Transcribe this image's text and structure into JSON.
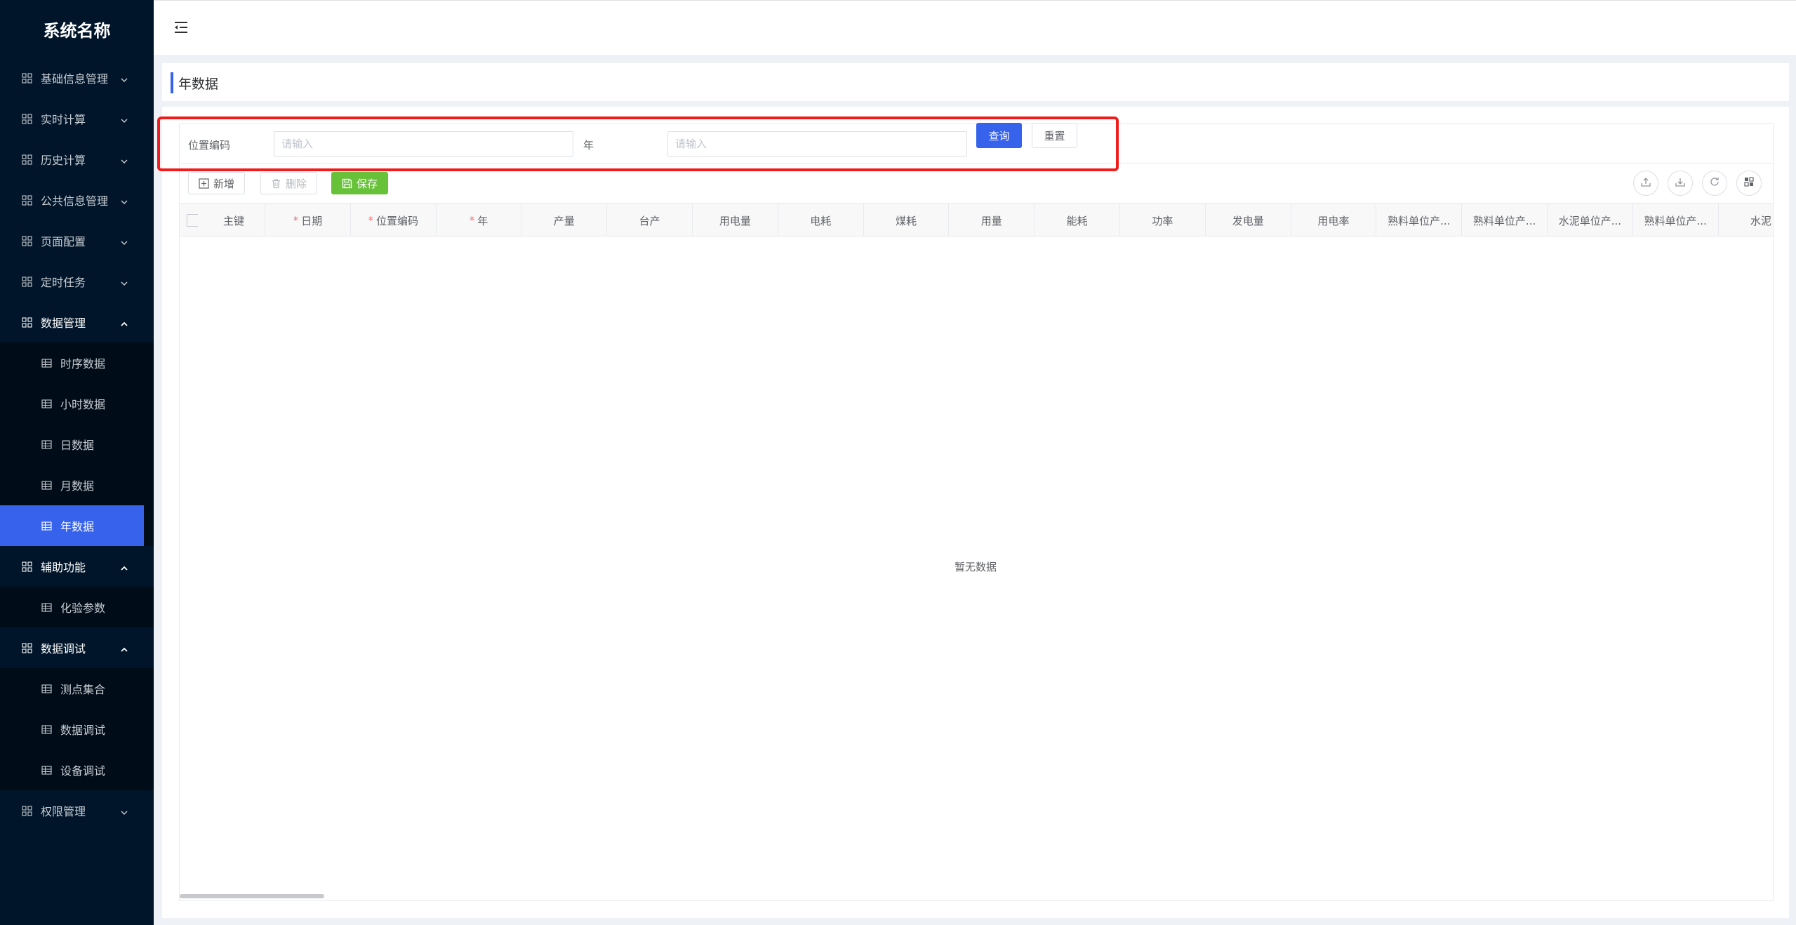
{
  "app": {
    "title": "系统名称"
  },
  "sidebar": {
    "items": [
      {
        "label": "基础信息管理",
        "open": false
      },
      {
        "label": "实时计算",
        "open": false
      },
      {
        "label": "历史计算",
        "open": false
      },
      {
        "label": "公共信息管理",
        "open": false
      },
      {
        "label": "页面配置",
        "open": false
      },
      {
        "label": "定时任务",
        "open": false
      },
      {
        "label": "数据管理",
        "open": true,
        "children": [
          "时序数据",
          "小时数据",
          "日数据",
          "月数据",
          "年数据"
        ],
        "active_child": "年数据"
      },
      {
        "label": "辅助功能",
        "open": true,
        "children": [
          "化验参数"
        ]
      },
      {
        "label": "数据调试",
        "open": true,
        "children": [
          "测点集合",
          "数据调试",
          "设备调试"
        ]
      },
      {
        "label": "权限管理",
        "open": false
      }
    ]
  },
  "page": {
    "title": "年数据"
  },
  "search": {
    "location_label": "位置编码",
    "location_placeholder": "请输入",
    "year_label": "年",
    "year_placeholder": "请输入",
    "query_label": "查询",
    "reset_label": "重置"
  },
  "toolbar": {
    "add_label": "新增",
    "delete_label": "删除",
    "save_label": "保存"
  },
  "table": {
    "columns": [
      {
        "label": "主键",
        "required": false
      },
      {
        "label": "日期",
        "required": true
      },
      {
        "label": "位置编码",
        "required": true
      },
      {
        "label": "年",
        "required": true
      },
      {
        "label": "产量",
        "required": false
      },
      {
        "label": "台产",
        "required": false
      },
      {
        "label": "用电量",
        "required": false
      },
      {
        "label": "电耗",
        "required": false
      },
      {
        "label": "煤耗",
        "required": false
      },
      {
        "label": "用量",
        "required": false
      },
      {
        "label": "能耗",
        "required": false
      },
      {
        "label": "功率",
        "required": false
      },
      {
        "label": "发电量",
        "required": false
      },
      {
        "label": "用电率",
        "required": false
      },
      {
        "label": "熟料单位产...",
        "required": false
      },
      {
        "label": "熟料单位产...",
        "required": false
      },
      {
        "label": "水泥单位产...",
        "required": false
      },
      {
        "label": "熟料单位产...",
        "required": false
      },
      {
        "label": "水泥",
        "required": false
      }
    ],
    "empty_text": "暂无数据"
  },
  "colors": {
    "sidebar_bg": "#001529",
    "accent": "#3662ec",
    "success": "#67c23a",
    "highlight": "#ee1c1c"
  }
}
